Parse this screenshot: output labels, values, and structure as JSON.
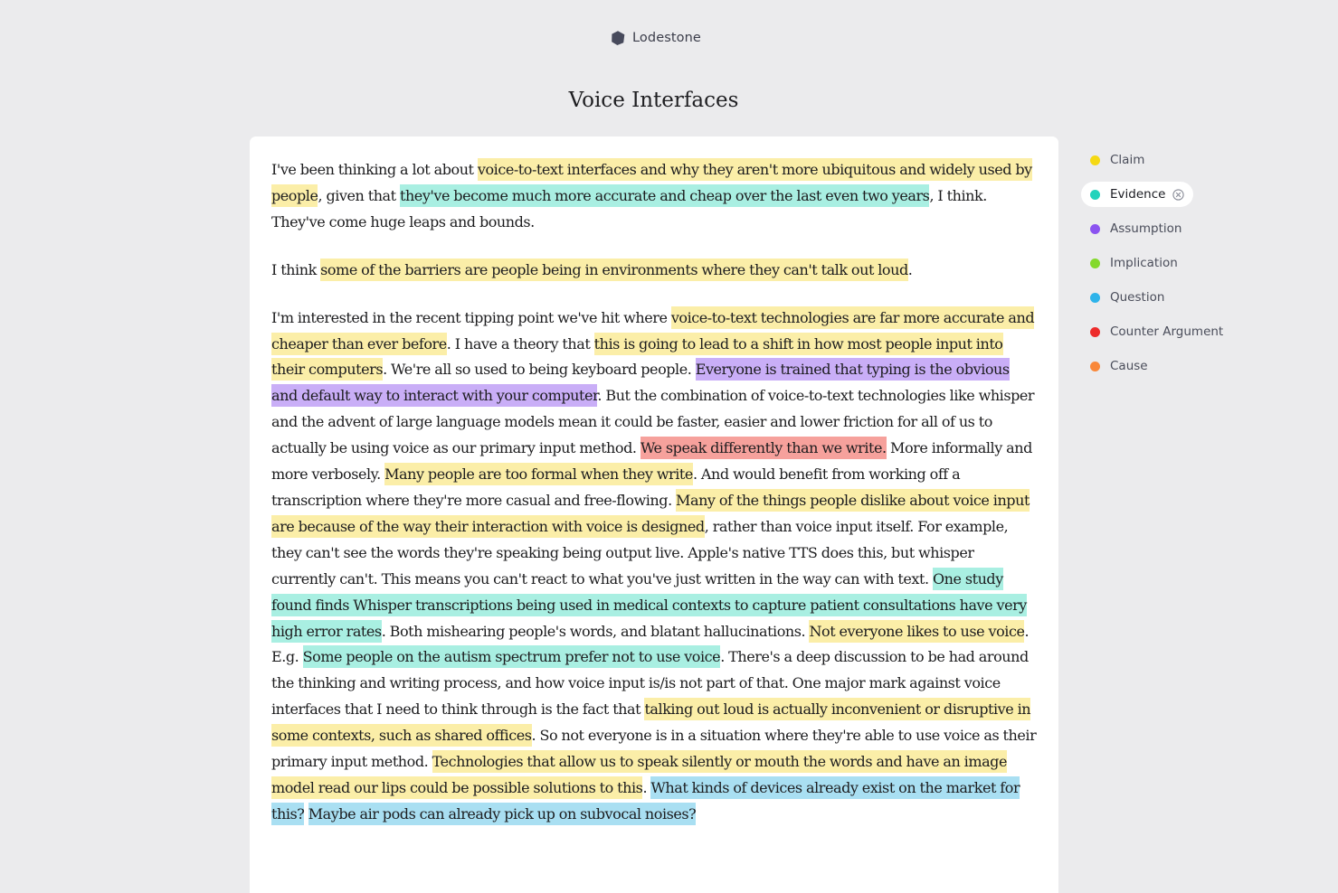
{
  "app": {
    "name": "Lodestone"
  },
  "document": {
    "title": "Voice Interfaces",
    "paragraphs": [
      [
        {
          "text": "I've been thinking a lot about "
        },
        {
          "text": "voice-to-text interfaces and why they aren't more ubiquitous and widely used by people",
          "tag": "claim"
        },
        {
          "text": ", given that "
        },
        {
          "text": "they've become much more accurate and cheap over the last even two years",
          "tag": "evidence"
        },
        {
          "text": ", I think. They've come huge leaps and bounds."
        }
      ],
      [
        {
          "text": "I think "
        },
        {
          "text": "some of the barriers are people being in environments where they can't talk out loud",
          "tag": "claim"
        },
        {
          "text": "."
        }
      ],
      [
        {
          "text": "I'm interested in the recent tipping point we've hit where "
        },
        {
          "text": "voice-to-text technologies are far more accurate and cheaper than ever before",
          "tag": "claim"
        },
        {
          "text": ". I have a theory that "
        },
        {
          "text": "this is going to lead to a shift in how most people input into their computers",
          "tag": "claim"
        },
        {
          "text": ". We're all so used to being keyboard people. "
        },
        {
          "text": "Everyone is trained that typing is the obvious and default way to interact with your computer",
          "tag": "assumption"
        },
        {
          "text": ". But the combination of voice-to-text technologies like whisper and the advent of large language models mean it could be faster, easier and lower friction for all of us to actually be using voice as our primary input method. "
        },
        {
          "text": "We speak differently than we write.",
          "tag": "counter"
        },
        {
          "text": " More informally and more verbosely. "
        },
        {
          "text": "Many people are too formal when they write",
          "tag": "claim"
        },
        {
          "text": ". And would benefit from working off a transcription where they're more casual and free-flowing. "
        },
        {
          "text": "Many of the things people dislike about voice input are because of the way their interaction with voice is designed",
          "tag": "claim"
        },
        {
          "text": ", rather than voice input itself. For example, they can't see the words they're speaking being output live. Apple's native TTS does this, but whisper currently can't. This means you can't react to what you've just written in the way can with text. "
        },
        {
          "text": "One study found finds Whisper transcriptions being used in medical contexts to capture patient consultations have very high error rates",
          "tag": "evidence"
        },
        {
          "text": ". Both mishearing people's words, and blatant hallucinations. "
        },
        {
          "text": "Not everyone likes to use voice",
          "tag": "claim"
        },
        {
          "text": ". E.g. "
        },
        {
          "text": "Some people on the autism spectrum prefer not to use voice",
          "tag": "evidence"
        },
        {
          "text": ". There's a deep discussion to be had around the thinking and writing process, and how voice input is/is not part of that. One major mark against voice interfaces that I need to think through is the fact that "
        },
        {
          "text": "talking out loud is actually inconvenient or disruptive in some contexts, such as shared offices",
          "tag": "claim"
        },
        {
          "text": ". So not everyone is in a situation where they're able to use voice as their primary input method. "
        },
        {
          "text": "Technologies that allow us to speak silently or mouth the words and have an image model read our lips could be possible solutions to this",
          "tag": "claim"
        },
        {
          "text": ". "
        },
        {
          "text": "What kinds of devices already exist on the market for this?",
          "tag": "question"
        },
        {
          "text": " "
        },
        {
          "text": "Maybe air pods can already pick up on subvocal noises?",
          "tag": "question"
        }
      ]
    ]
  },
  "highlight_colors": {
    "claim": "#fbeea8",
    "evidence": "#a9efe2",
    "assumption": "#c9aef7",
    "counter": "#f6a19c",
    "question": "#a9dff2"
  },
  "legend": {
    "items": [
      {
        "label": "Claim",
        "color": "#f5d914",
        "active": false
      },
      {
        "label": "Evidence",
        "color": "#22d3bc",
        "active": true
      },
      {
        "label": "Assumption",
        "color": "#8b53f0",
        "active": false
      },
      {
        "label": "Implication",
        "color": "#84d92d",
        "active": false
      },
      {
        "label": "Question",
        "color": "#2eb3ea",
        "active": false
      },
      {
        "label": "Counter Argument",
        "color": "#ed2b2b",
        "active": false
      },
      {
        "label": "Cause",
        "color": "#f9883a",
        "active": false
      }
    ]
  }
}
